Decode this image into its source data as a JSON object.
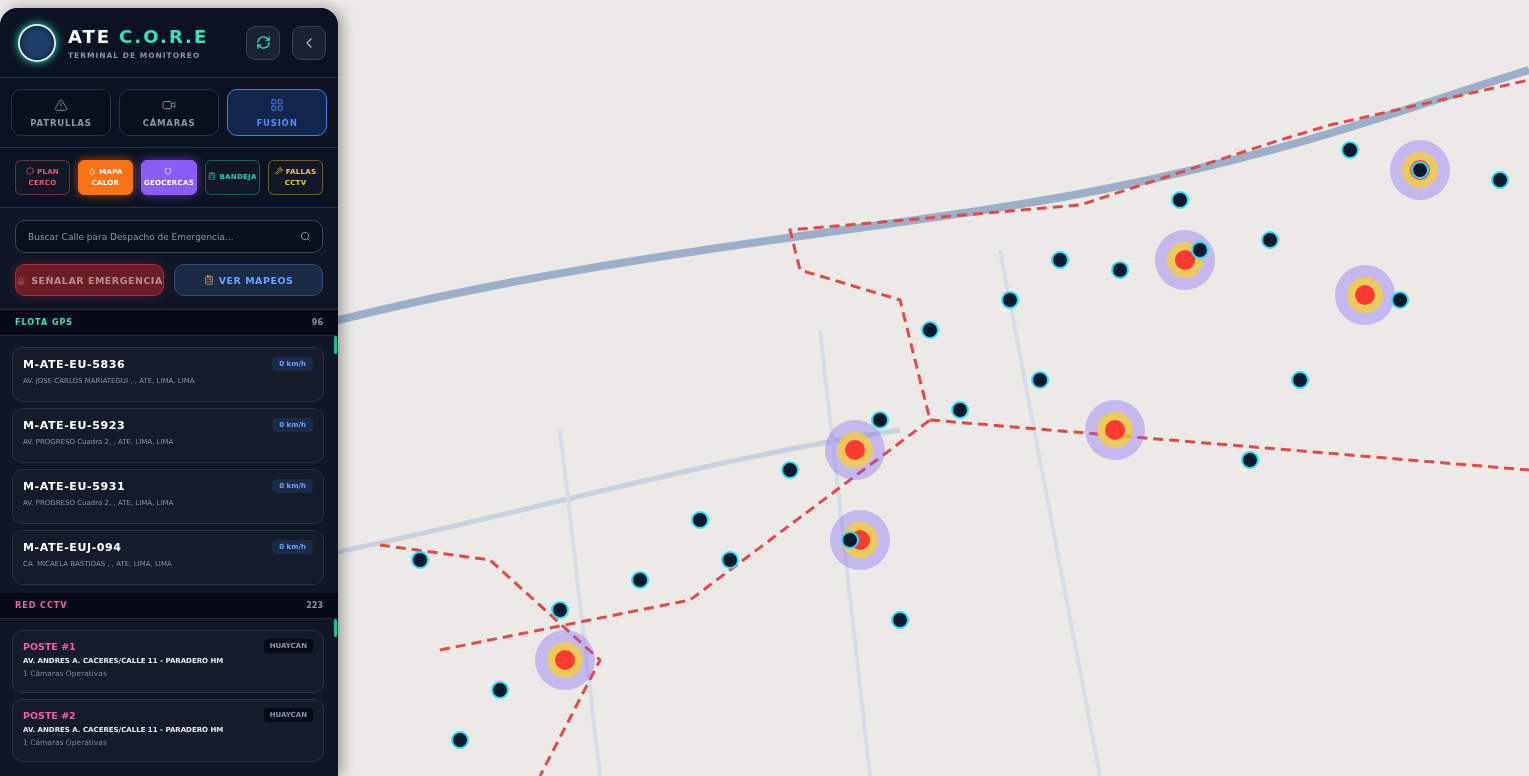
{
  "header": {
    "title": "ATE",
    "title_accent": "C.O.R.E",
    "subtitle": "TERMINAL DE MONITOREO"
  },
  "tabs": [
    {
      "label": "PATRULLAS",
      "selected": false
    },
    {
      "label": "CÁMARAS",
      "selected": false
    },
    {
      "label": "FUSIÓN",
      "selected": true
    }
  ],
  "layers": [
    {
      "label": "PLAN CERCO",
      "color": "#f05a6e",
      "on": false
    },
    {
      "label": "MAPA CALOR",
      "color": "#f97316",
      "on": true
    },
    {
      "label": "GEOCERCAS",
      "color": "#8b5cf6",
      "on": true
    },
    {
      "label": "BANDEJA",
      "color": "#14d3b0",
      "on": false
    },
    {
      "label": "FALLAS CCTV",
      "color": "#facc15",
      "on": false
    }
  ],
  "search": {
    "placeholder": "Buscar Calle para Despacho de Emergencia..."
  },
  "actions": [
    {
      "label": "SEÑALAR EMERGENCIA",
      "kind": "danger"
    },
    {
      "label": "VER MAPEOS",
      "kind": "info"
    }
  ],
  "fleet": {
    "title": "FLOTA GPS",
    "count": "96",
    "units": [
      {
        "id": "M-ATE-EU-5836",
        "address": "AV. JOSE CARLOS MARIATEGUI , , ATE, LIMA, LIMA",
        "speed": "0 km/h"
      },
      {
        "id": "M-ATE-EU-5923",
        "address": "AV. PROGRESO Cuadra 2, , ATE, LIMA, LIMA",
        "speed": "0 km/h"
      },
      {
        "id": "M-ATE-EU-5931",
        "address": "AV. PROGRESO Cuadra 2, , ATE, LIMA, LIMA",
        "speed": "0 km/h"
      },
      {
        "id": "M-ATE-EUJ-094",
        "address": "CA. MICAELA BASTIDAS , , ATE, LIMA, LIMA",
        "speed": "0 km/h"
      }
    ]
  },
  "cctv": {
    "title": "RED CCTV",
    "count": "223",
    "posts": [
      {
        "name": "POSTE #1",
        "zone": "HUAYCAN",
        "address": "AV. ANDRES A. CACERES/CALLE 11 - PARADERO HM",
        "note": "1 Cámaras Operativas"
      },
      {
        "name": "POSTE #2",
        "zone": "HUAYCAN",
        "address": "AV. ANDRES A. CACERES/CALLE 11 - PARADERO HM",
        "note": "1 Cámaras Operativas"
      }
    ]
  }
}
